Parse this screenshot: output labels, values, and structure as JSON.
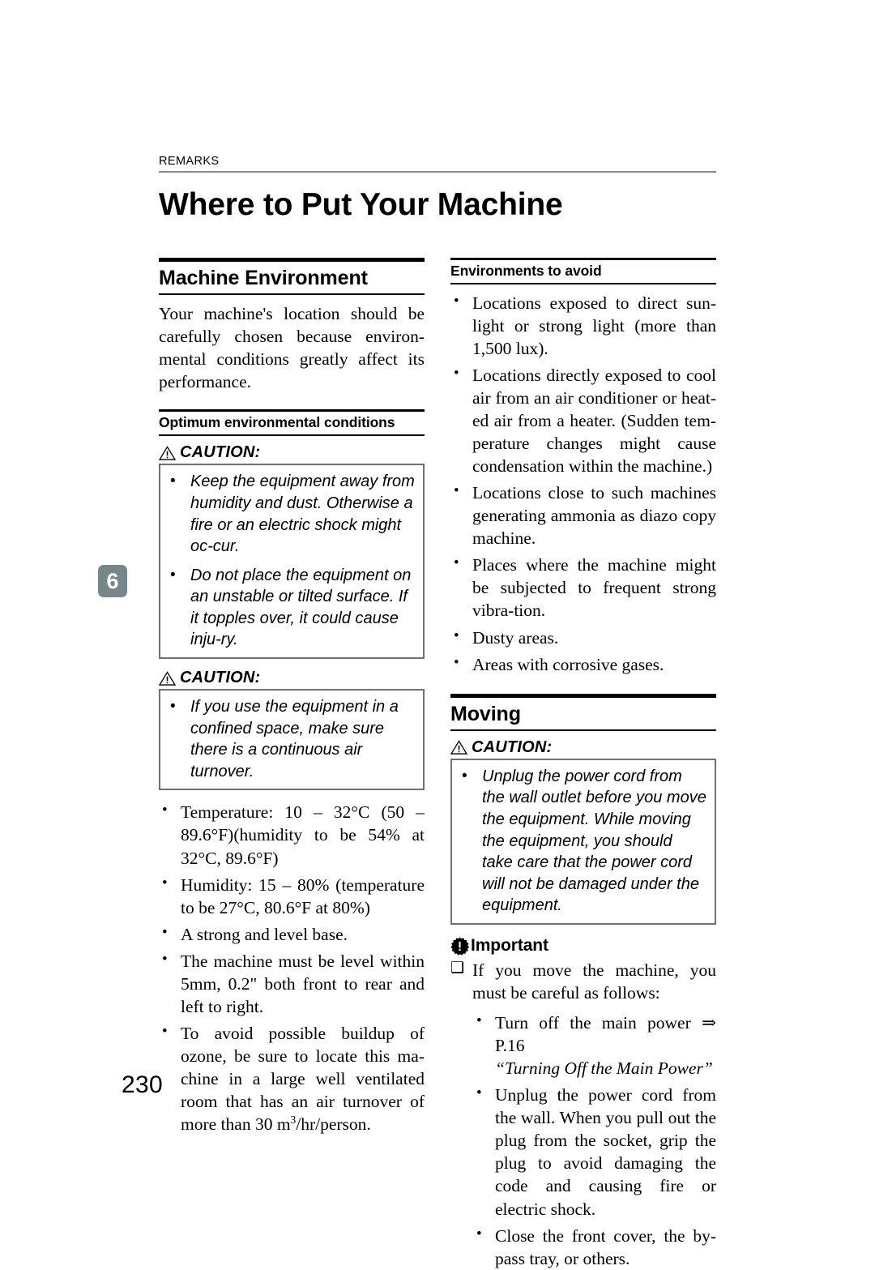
{
  "header": {
    "running_label": "REMARKS"
  },
  "page_title": "Where to Put Your Machine",
  "chapter_tab": "6",
  "page_number": "230",
  "left_column": {
    "section": {
      "heading": "Machine Environment",
      "intro": "Your machine's location should be carefully chosen because environ-mental conditions greatly affect its performance."
    },
    "subsection": {
      "heading": "Optimum environmental conditions"
    },
    "caution_1": {
      "label": "CAUTION:",
      "icon": "warning-triangle-icon",
      "items": [
        "Keep the equipment away from humidity and dust. Otherwise a fire or an electric shock might oc-cur.",
        "Do not place the equipment on an unstable or tilted surface. If it topples over, it could cause inju-ry."
      ]
    },
    "caution_2": {
      "label": "CAUTION:",
      "icon": "warning-triangle-icon",
      "items": [
        "If you use the equipment in a confined space, make sure there is a continuous air turnover."
      ]
    },
    "conditions": [
      "Temperature: 10 – 32°C (50 – 89.6°F)(humidity to be 54% at 32°C, 89.6°F)",
      "Humidity: 15 – 80% (temperature to be 27°C, 80.6°F at 80%)",
      "A strong and level base.",
      "The machine must be level within 5mm, 0.2\" both front to rear and left to right.",
      "To avoid possible buildup of ozone, be sure to locate this ma-chine in a large well ventilated room that has an air turnover of more than 30 m3/hr/person."
    ],
    "ozone_prefix": "To avoid possible buildup of ozone, be sure to locate this ma-chine in a large well ventilated room that has an air turnover of more than 30 m",
    "ozone_sup": "3",
    "ozone_suffix": "/hr/person."
  },
  "right_column": {
    "subsection": {
      "heading": "Environments to avoid"
    },
    "avoid_items": [
      "Locations exposed to direct sun-light or strong light (more than 1,500 lux).",
      "Locations directly exposed to cool air from an air conditioner or heat-ed air from a heater. (Sudden tem-perature changes might cause condensation within the machine.)",
      "Locations close to such machines generating ammonia as diazo copy machine.",
      "Places where the machine might be subjected to frequent strong vibra-tion.",
      "Dusty areas.",
      "Areas with corrosive gases."
    ],
    "moving_section": {
      "heading": "Moving"
    },
    "caution_moving": {
      "label": "CAUTION:",
      "icon": "warning-triangle-icon",
      "items": [
        "Unplug the power cord from the wall outlet before you move the equipment. While moving the equipment, you should take care that the power cord will not be damaged under the equipment."
      ]
    },
    "important": {
      "icon": "important-burst-icon",
      "label": "Important",
      "lead": "If you move the machine, you must be careful as follows:",
      "items": [
        {
          "text": "Turn off the main power ⇒ P.16",
          "reference": "“Turning Off the Main Power”"
        },
        {
          "text": "Unplug the power cord from the wall. When you pull out the plug from the socket, grip the plug to avoid damaging the code and causing fire or electric shock.",
          "reference": ""
        },
        {
          "text": "Close the front cover, the by-pass tray, or others.",
          "reference": ""
        }
      ]
    }
  },
  "colors": {
    "rule_dark": "#000000",
    "header_rule": "#8a8a8a",
    "box_border": "#707070",
    "chapter_tab_bg": "#76878a",
    "text": "#000000"
  }
}
